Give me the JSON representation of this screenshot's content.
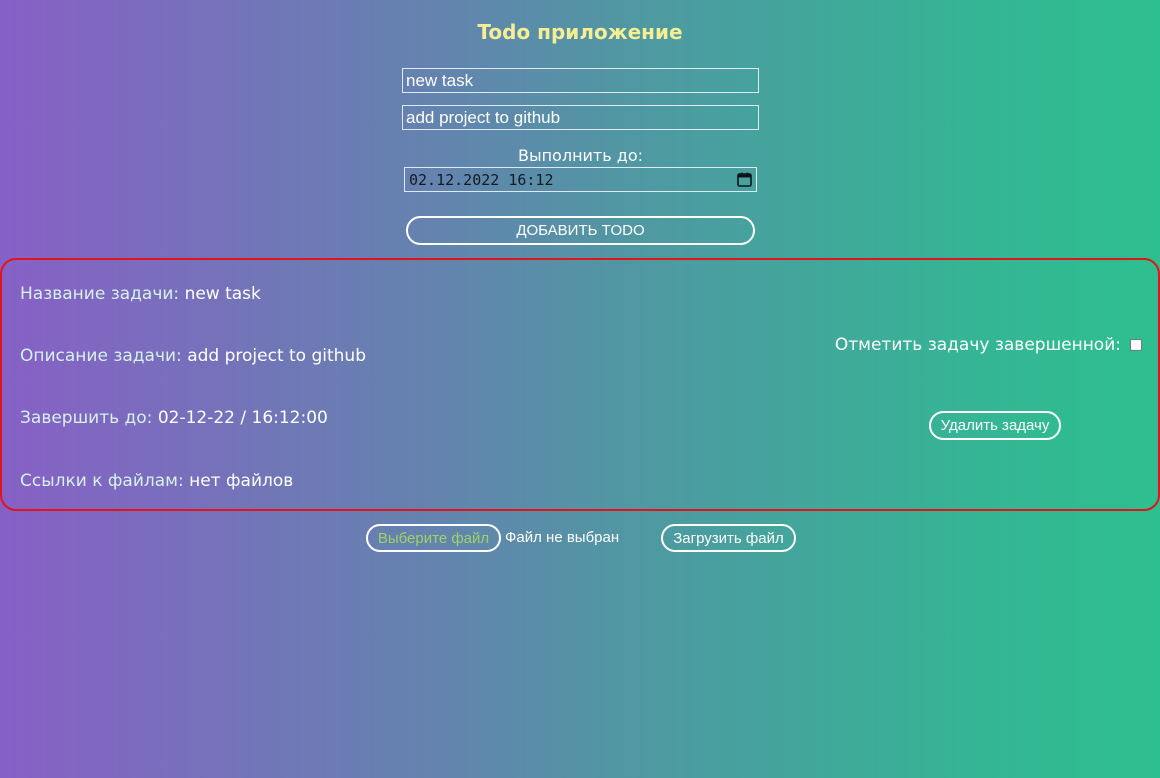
{
  "app": {
    "title": "Todo приложение"
  },
  "form": {
    "title_value": "new task",
    "description_value": "add project to github",
    "deadline_label": "Выполнить до:",
    "deadline_value": "02.12.2022 16:12",
    "add_button": "ДОБАВИТЬ TODO"
  },
  "task": {
    "name_label": "Название задачи:",
    "name_value": "new task",
    "desc_label": "Описание задачи:",
    "desc_value": "add project to github",
    "due_label": "Завершить до:",
    "due_value": "02-12-22 / 16:12:00",
    "files_label": "Ссылки к файлам:",
    "files_value": "нет файлов",
    "complete_label": "Отметить задачу завершенной:",
    "complete_checked": false,
    "delete_button": "Удалить задачу"
  },
  "upload": {
    "choose_button": "Выберите файл",
    "no_file_text": "Файл не выбран",
    "upload_button": "Загрузить файл"
  },
  "colors": {
    "title": "#f6ee95",
    "card_border": "#e0141b",
    "choose_file_text": "#9ed264"
  },
  "icons": {
    "date_picker": "calendar-icon"
  }
}
